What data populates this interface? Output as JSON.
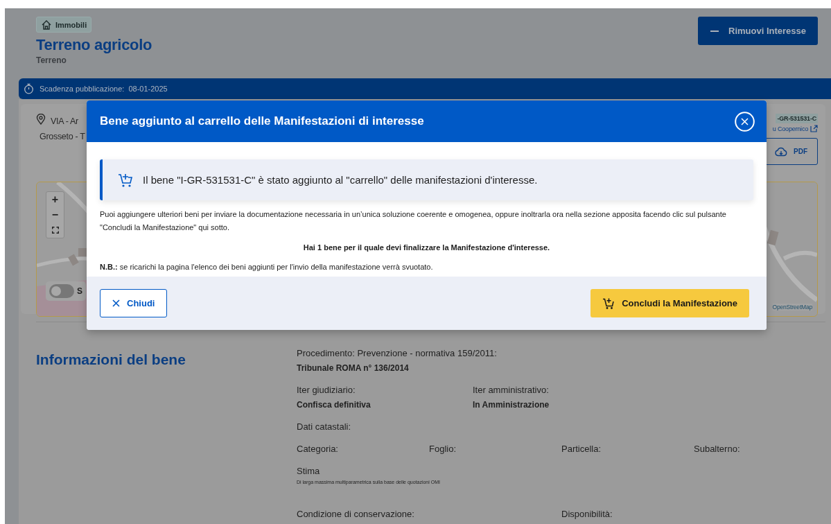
{
  "header": {
    "badge": "Immobili",
    "title": "Terreno agricolo",
    "subtitle": "Terreno",
    "remove_button": "Rimuovi Interesse"
  },
  "deadline_bar": {
    "label": "Scadenza pubblicazione:",
    "date": "08-01-2025"
  },
  "property_card": {
    "address_lines": [
      "VIA - Ar",
      "Grosseto - T"
    ],
    "code": "-GR-531531-C",
    "link": "u Coopernico",
    "pdf_button": "PDF",
    "map": {
      "kind": "picture",
      "zoom_controls": [
        "+",
        "−"
      ],
      "toggle": {
        "label": "S",
        "on": false
      },
      "attribution": "OpenStreetMap"
    }
  },
  "info_section": {
    "title": "Informazioni del bene",
    "rows": [
      {
        "kind": "single",
        "items": [
          {
            "label": "Procedimento: Prevenzione - normativa 159/2011:",
            "value": "Tribunale ROMA n° 136/2014"
          }
        ]
      },
      {
        "kind": "half",
        "items": [
          {
            "label": "Iter giudiziario:",
            "value": "Confisca definitiva"
          },
          {
            "label": "Iter amministrativo:",
            "value": "In Amministrazione"
          }
        ]
      },
      {
        "kind": "single",
        "items": [
          {
            "label": "Dati catastali:"
          }
        ]
      },
      {
        "kind": "quarter",
        "items": [
          {
            "label": "Categoria:"
          },
          {
            "label": "Foglio:"
          },
          {
            "label": "Particella:"
          },
          {
            "label": "Subalterno:"
          }
        ]
      },
      {
        "kind": "single",
        "items": [
          {
            "label": "Stima",
            "note": "Di larga massima multiparametrica sulla base delle quotazioni OMI"
          }
        ]
      },
      {
        "kind": "split",
        "items": [
          {
            "label": "Condizione di conservazione:"
          },
          {
            "label": "Disponibilità:"
          }
        ]
      }
    ]
  },
  "modal": {
    "title": "Bene aggiunto al carrello delle Manifestazioni di interesse",
    "alert": "Il bene \"I-GR-531531-C\" è stato aggiunto al \"carrello\" delle manifestazioni d'interesse.",
    "paragraph": "Puoi aggiungere ulteriori beni per inviare la documentazione necessaria in un’unica soluzione coerente e omogenea, oppure inoltrarla ora nella sezione apposita facendo clic sul pulsante \"Concludi la Manifestazione\" qui sotto.",
    "summary": "Hai 1 bene per il quale devi finalizzare la Manifestazione d'interesse.",
    "note": "**N.B.:** se ricarichi la pagina l'elenco dei beni aggiunti per l'invio della manifestazione verrà svuotato.",
    "buttons": [
      {
        "label": "Chiudi",
        "kind": "secondary"
      },
      {
        "label": "Concludi la Manifestazione",
        "kind": "primary"
      }
    ]
  }
}
